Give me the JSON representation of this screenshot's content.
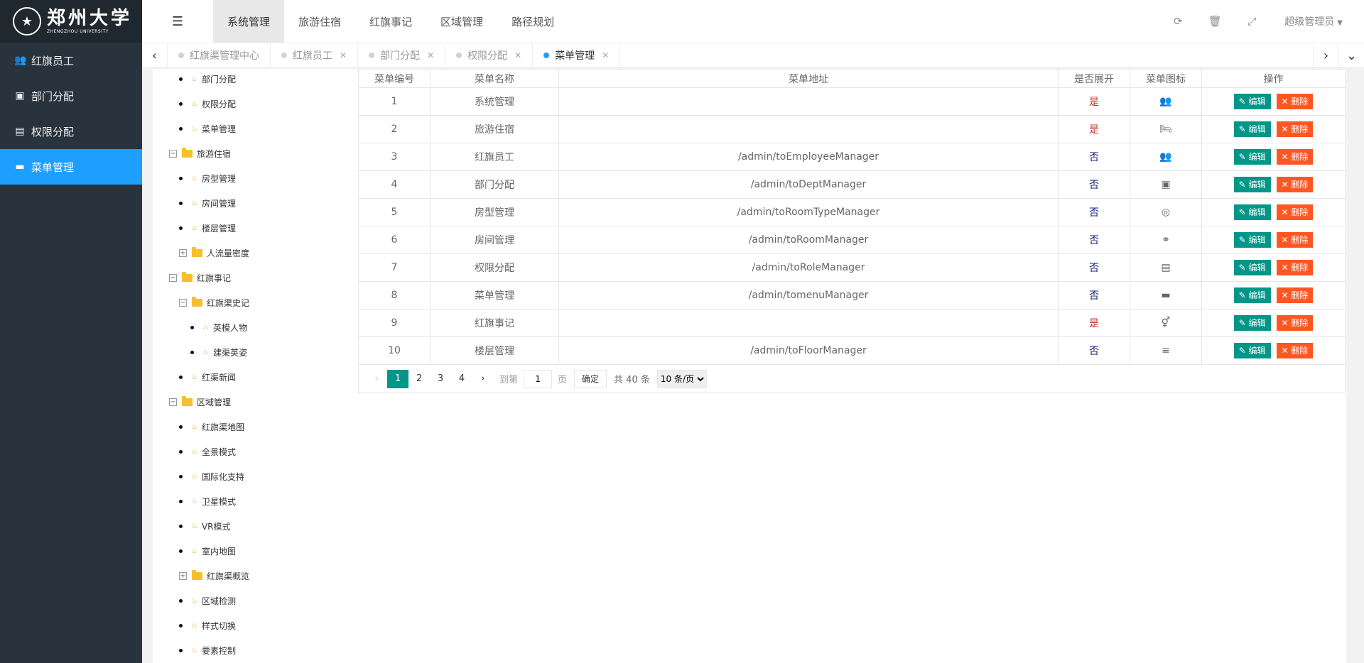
{
  "logo": {
    "name_cn": "郑州大学",
    "name_en": "ZHENGZHOU UNIVERSITY"
  },
  "sidebar": {
    "items": [
      {
        "label": "红旗员工",
        "icon": "users-icon"
      },
      {
        "label": "部门分配",
        "icon": "id-card-icon"
      },
      {
        "label": "权限分配",
        "icon": "portrait-icon"
      },
      {
        "label": "菜单管理",
        "icon": "briefcase-icon",
        "active": true
      }
    ]
  },
  "header": {
    "tabs": [
      "系统管理",
      "旅游住宿",
      "红旗事记",
      "区域管理",
      "路径规划"
    ],
    "active_tab": "系统管理",
    "user": "超级管理员"
  },
  "tabbar": {
    "tabs": [
      {
        "label": "红旗渠管理中心",
        "closable": false
      },
      {
        "label": "红旗员工",
        "closable": true
      },
      {
        "label": "部门分配",
        "closable": true
      },
      {
        "label": "权限分配",
        "closable": true
      },
      {
        "label": "菜单管理",
        "closable": true,
        "active": true
      }
    ]
  },
  "tree": {
    "nodes": [
      {
        "label": "部门分配",
        "type": "leaf"
      },
      {
        "label": "权限分配",
        "type": "leaf"
      },
      {
        "label": "菜单管理",
        "type": "leaf"
      },
      {
        "label": "旅游住宿",
        "type": "folder-open"
      },
      {
        "label": "房型管理",
        "type": "leaf"
      },
      {
        "label": "房间管理",
        "type": "leaf"
      },
      {
        "label": "楼层管理",
        "type": "leaf"
      },
      {
        "label": "人流量密度",
        "type": "folder-closed"
      },
      {
        "label": "红旗事记",
        "type": "folder-open"
      },
      {
        "label": "红旗渠史记",
        "type": "folder-open"
      },
      {
        "label": "英模人物",
        "type": "leaf"
      },
      {
        "label": "建渠英姿",
        "type": "leaf"
      },
      {
        "label": "红渠新闻",
        "type": "leaf"
      },
      {
        "label": "区域管理",
        "type": "folder-open"
      },
      {
        "label": "红旗渠地图",
        "type": "leaf"
      },
      {
        "label": "全景模式",
        "type": "leaf"
      },
      {
        "label": "国际化支持",
        "type": "leaf"
      },
      {
        "label": "卫星模式",
        "type": "leaf"
      },
      {
        "label": "VR模式",
        "type": "leaf"
      },
      {
        "label": "室内地图",
        "type": "leaf"
      },
      {
        "label": "红旗渠概览",
        "type": "folder-closed"
      },
      {
        "label": "区域检测",
        "type": "leaf"
      },
      {
        "label": "样式切换",
        "type": "leaf"
      },
      {
        "label": "要素控制",
        "type": "leaf"
      }
    ]
  },
  "table": {
    "headers": [
      "菜单编号",
      "菜单名称",
      "菜单地址",
      "是否展开",
      "菜单图标",
      "操作"
    ],
    "edit_label": "编辑",
    "delete_label": "删除",
    "rows": [
      {
        "id": "1",
        "name": "系统管理",
        "url": "",
        "expand": "是",
        "icon": "users-icon",
        "glyph": "👥"
      },
      {
        "id": "2",
        "name": "旅游住宿",
        "url": "",
        "expand": "是",
        "icon": "bed-icon",
        "glyph": "🛏"
      },
      {
        "id": "3",
        "name": "红旗员工",
        "url": "/admin/toEmployeeManager",
        "expand": "否",
        "icon": "users-icon",
        "glyph": "👥"
      },
      {
        "id": "4",
        "name": "部门分配",
        "url": "/admin/toDeptManager",
        "expand": "否",
        "icon": "id-card-icon",
        "glyph": "▣"
      },
      {
        "id": "5",
        "name": "房型管理",
        "url": "/admin/toRoomTypeManager",
        "expand": "否",
        "icon": "target-icon",
        "glyph": "◎"
      },
      {
        "id": "6",
        "name": "房间管理",
        "url": "/admin/toRoomManager",
        "expand": "否",
        "icon": "handshake-icon",
        "glyph": "⚭"
      },
      {
        "id": "7",
        "name": "权限分配",
        "url": "/admin/toRoleManager",
        "expand": "否",
        "icon": "portrait-icon",
        "glyph": "▤"
      },
      {
        "id": "8",
        "name": "菜单管理",
        "url": "/admin/tomenuManager",
        "expand": "否",
        "icon": "briefcase-icon",
        "glyph": "▬"
      },
      {
        "id": "9",
        "name": "红旗事记",
        "url": "",
        "expand": "是",
        "icon": "venus-mars-icon",
        "glyph": "⚥"
      },
      {
        "id": "10",
        "name": "楼层管理",
        "url": "/admin/toFloorManager",
        "expand": "否",
        "icon": "align-left-icon",
        "glyph": "≡"
      }
    ]
  },
  "pager": {
    "pages": [
      "1",
      "2",
      "3",
      "4"
    ],
    "current": "1",
    "goto_label": "到第",
    "goto_value": "1",
    "page_unit": "页",
    "confirm_label": "确定",
    "total_text": "共 40 条",
    "page_size": "10 条/页"
  },
  "colors": {
    "accent": "#1e9fff",
    "edit": "#009688",
    "delete": "#ff5722",
    "sidebar": "#28333e"
  }
}
